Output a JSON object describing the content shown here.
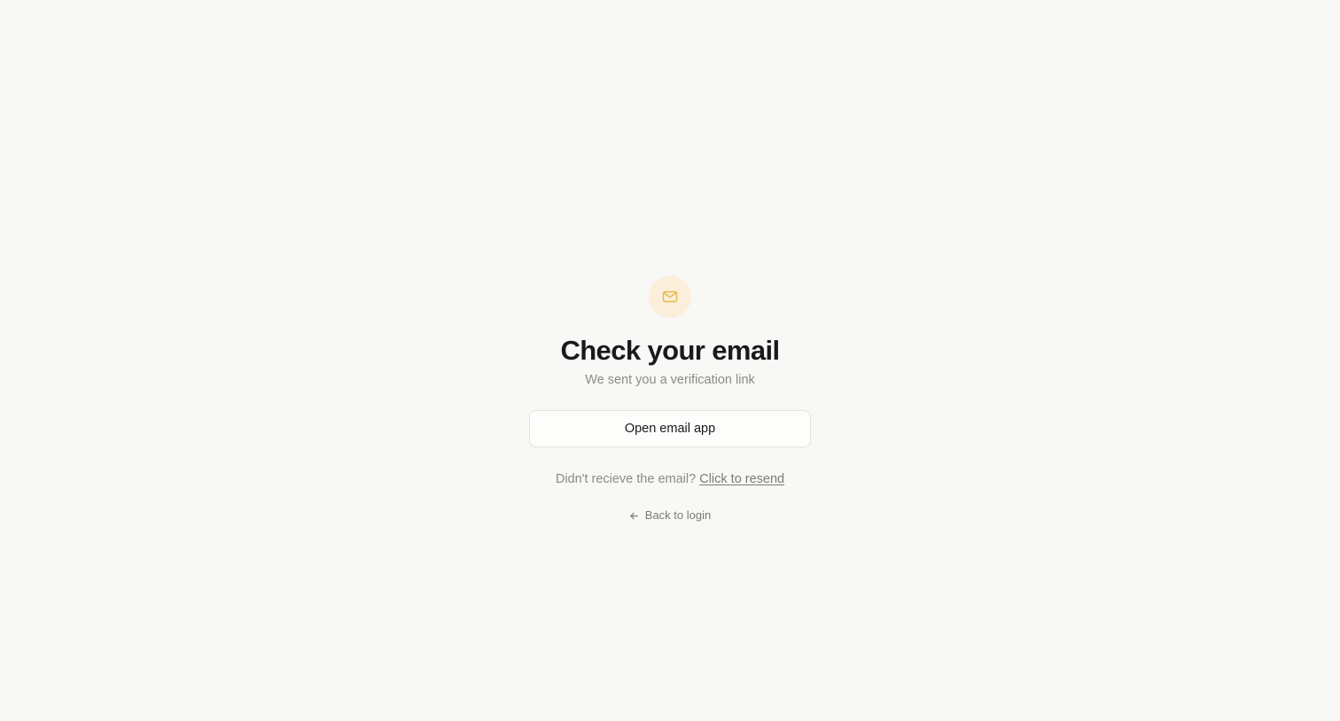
{
  "page": {
    "icon": "mail-icon",
    "title": "Check your email",
    "subtitle": "We sent you a verification link"
  },
  "actions": {
    "open_email_label": "Open email app",
    "resend_prompt": "Didn't recieve the email?",
    "resend_label": "Click to resend",
    "back_icon": "arrow-left-icon",
    "back_label": "Back to login"
  },
  "colors": {
    "background": "#f8f8f6",
    "icon_accent": "#e8b84a",
    "icon_bg": "#fbefdc",
    "title": "#1a1a1a",
    "muted_text": "#8a8a86"
  }
}
